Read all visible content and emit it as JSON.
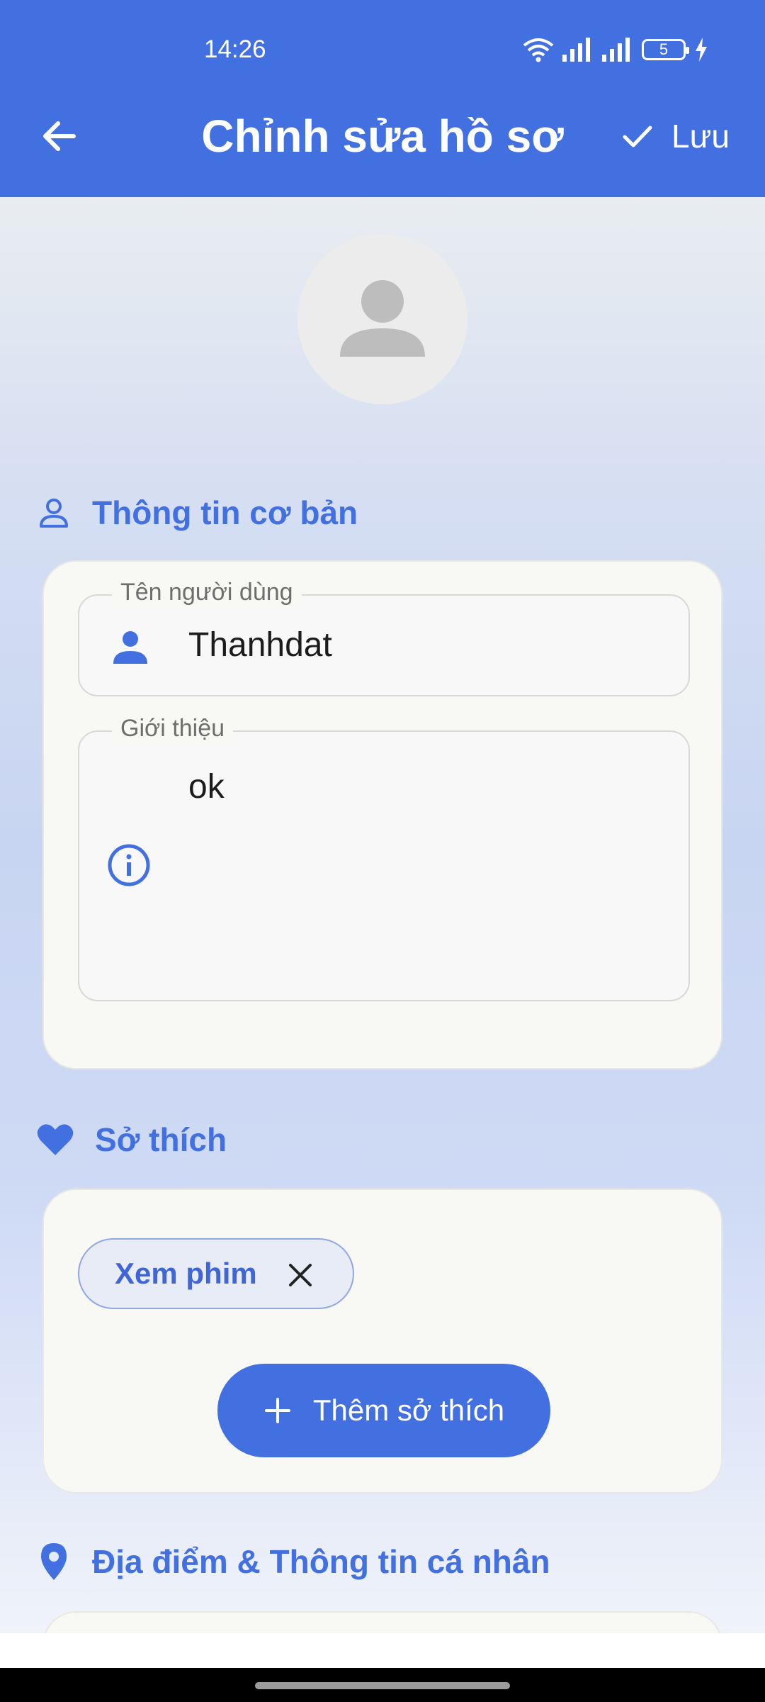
{
  "status_bar": {
    "time": "14:26",
    "battery": "5"
  },
  "app_bar": {
    "title": "Chỉnh sửa hồ sơ",
    "save_label": "Lưu"
  },
  "sections": {
    "basic": {
      "title": "Thông tin cơ bản",
      "username": {
        "label": "Tên người dùng",
        "value": "Thanhdat"
      },
      "bio": {
        "label": "Giới thiệu",
        "value": "ok"
      }
    },
    "interests": {
      "title": "Sở thích",
      "chips": [
        "Xem phim"
      ],
      "add_label": "Thêm sở thích"
    },
    "location": {
      "title": "Địa điểm & Thông tin cá nhân"
    }
  },
  "colors": {
    "primary": "#4370e0",
    "card": "#f8f8f4"
  }
}
